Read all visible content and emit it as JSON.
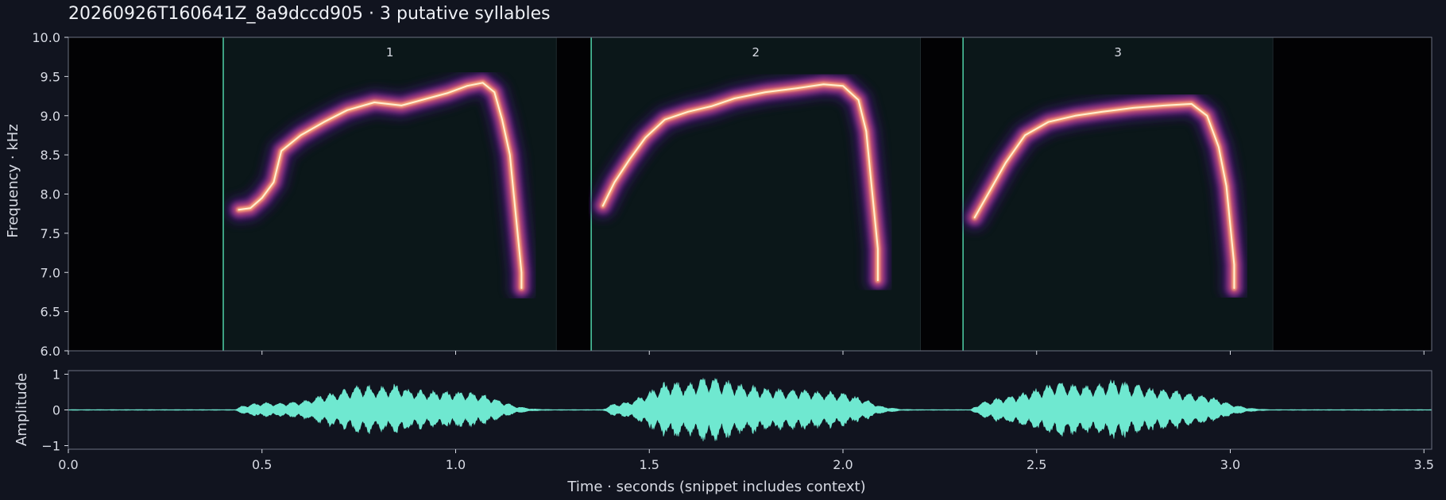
{
  "title": "20260926T160641Z_8a9dccd905  ·  3 putative syllables",
  "chart_data": [
    {
      "type": "heatmap",
      "name": "spectrogram",
      "ylabel": "Frequency · kHz",
      "xlim": [
        0.0,
        3.52
      ],
      "ylim": [
        6.0,
        10.0
      ],
      "yticks": [
        "6.0",
        "6.5",
        "7.0",
        "7.5",
        "8.0",
        "8.5",
        "9.0",
        "9.5",
        "10.0"
      ],
      "syllables": [
        {
          "label": "1",
          "start": 0.4,
          "end": 1.26,
          "contour": [
            [
              0.44,
              7.8
            ],
            [
              0.47,
              7.82
            ],
            [
              0.5,
              7.95
            ],
            [
              0.53,
              8.15
            ],
            [
              0.55,
              8.55
            ],
            [
              0.6,
              8.75
            ],
            [
              0.66,
              8.92
            ],
            [
              0.72,
              9.07
            ],
            [
              0.79,
              9.17
            ],
            [
              0.86,
              9.13
            ],
            [
              0.92,
              9.21
            ],
            [
              0.98,
              9.29
            ],
            [
              1.03,
              9.38
            ],
            [
              1.07,
              9.42
            ],
            [
              1.1,
              9.3
            ],
            [
              1.12,
              8.95
            ],
            [
              1.14,
              8.5
            ],
            [
              1.15,
              8.0
            ],
            [
              1.16,
              7.5
            ],
            [
              1.17,
              7.0
            ],
            [
              1.17,
              6.8
            ]
          ]
        },
        {
          "label": "2",
          "start": 1.35,
          "end": 2.2,
          "contour": [
            [
              1.38,
              7.85
            ],
            [
              1.41,
              8.15
            ],
            [
              1.45,
              8.45
            ],
            [
              1.49,
              8.72
            ],
            [
              1.54,
              8.95
            ],
            [
              1.6,
              9.05
            ],
            [
              1.66,
              9.12
            ],
            [
              1.72,
              9.22
            ],
            [
              1.8,
              9.3
            ],
            [
              1.88,
              9.35
            ],
            [
              1.95,
              9.4
            ],
            [
              2.0,
              9.38
            ],
            [
              2.04,
              9.2
            ],
            [
              2.06,
              8.8
            ],
            [
              2.07,
              8.3
            ],
            [
              2.08,
              7.8
            ],
            [
              2.09,
              7.3
            ],
            [
              2.09,
              6.9
            ]
          ]
        },
        {
          "label": "3",
          "start": 2.31,
          "end": 3.11,
          "contour": [
            [
              2.34,
              7.7
            ],
            [
              2.38,
              8.05
            ],
            [
              2.42,
              8.4
            ],
            [
              2.47,
              8.75
            ],
            [
              2.53,
              8.92
            ],
            [
              2.6,
              9.0
            ],
            [
              2.67,
              9.05
            ],
            [
              2.75,
              9.1
            ],
            [
              2.83,
              9.13
            ],
            [
              2.9,
              9.15
            ],
            [
              2.94,
              9.0
            ],
            [
              2.97,
              8.6
            ],
            [
              2.99,
              8.1
            ],
            [
              3.0,
              7.6
            ],
            [
              3.01,
              7.1
            ],
            [
              3.01,
              6.8
            ]
          ]
        }
      ]
    },
    {
      "type": "area",
      "name": "waveform",
      "xlabel": "Time · seconds (snippet includes context)",
      "ylabel": "Amplitude",
      "xlim": [
        0.0,
        3.52
      ],
      "ylim": [
        -1.1,
        1.1
      ],
      "xticks": [
        "0.0",
        "0.5",
        "1.0",
        "1.5",
        "2.0",
        "2.5",
        "3.0",
        "3.5"
      ],
      "yticks": [
        "−1",
        "0",
        "1"
      ],
      "envelope": [
        [
          0.0,
          0.01
        ],
        [
          0.43,
          0.01
        ],
        [
          0.45,
          0.12
        ],
        [
          0.5,
          0.22
        ],
        [
          0.55,
          0.2
        ],
        [
          0.6,
          0.25
        ],
        [
          0.65,
          0.42
        ],
        [
          0.7,
          0.55
        ],
        [
          0.75,
          0.72
        ],
        [
          0.8,
          0.68
        ],
        [
          0.85,
          0.75
        ],
        [
          0.9,
          0.58
        ],
        [
          0.95,
          0.55
        ],
        [
          1.0,
          0.55
        ],
        [
          1.05,
          0.52
        ],
        [
          1.1,
          0.35
        ],
        [
          1.15,
          0.12
        ],
        [
          1.2,
          0.03
        ],
        [
          1.25,
          0.01
        ],
        [
          1.38,
          0.01
        ],
        [
          1.4,
          0.15
        ],
        [
          1.45,
          0.25
        ],
        [
          1.5,
          0.55
        ],
        [
          1.55,
          0.85
        ],
        [
          1.6,
          0.78
        ],
        [
          1.65,
          1.0
        ],
        [
          1.7,
          0.85
        ],
        [
          1.75,
          0.72
        ],
        [
          1.8,
          0.65
        ],
        [
          1.85,
          0.62
        ],
        [
          1.9,
          0.6
        ],
        [
          1.95,
          0.55
        ],
        [
          2.0,
          0.5
        ],
        [
          2.05,
          0.35
        ],
        [
          2.1,
          0.1
        ],
        [
          2.15,
          0.02
        ],
        [
          2.2,
          0.01
        ],
        [
          2.33,
          0.01
        ],
        [
          2.35,
          0.18
        ],
        [
          2.4,
          0.35
        ],
        [
          2.45,
          0.45
        ],
        [
          2.5,
          0.62
        ],
        [
          2.55,
          0.85
        ],
        [
          2.6,
          0.8
        ],
        [
          2.65,
          0.72
        ],
        [
          2.7,
          0.9
        ],
        [
          2.75,
          0.75
        ],
        [
          2.8,
          0.65
        ],
        [
          2.85,
          0.58
        ],
        [
          2.9,
          0.5
        ],
        [
          2.95,
          0.4
        ],
        [
          3.0,
          0.18
        ],
        [
          3.05,
          0.05
        ],
        [
          3.1,
          0.01
        ],
        [
          3.52,
          0.01
        ]
      ]
    }
  ],
  "colors": {
    "background": "#11141f",
    "plot_outside": "#020204",
    "syllable_region": "#0b1719",
    "syllable_boundary": "#4fd1a8",
    "waveform": "#6fe8d0",
    "axis": "#6b7080",
    "text": "#d8dbe4"
  }
}
